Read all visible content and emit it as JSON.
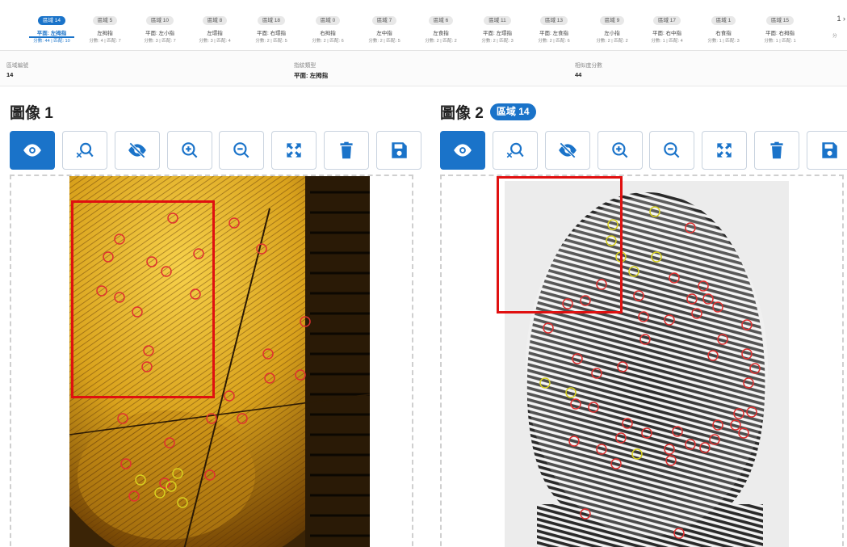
{
  "tabs": [
    {
      "area": "區域 14",
      "type": "平面: 左拇指",
      "score": "分數: 44 | 匹配: 10",
      "active": true
    },
    {
      "area": "區域 5",
      "type": "左拇指",
      "score": "分數: 4 | 匹配: 7"
    },
    {
      "area": "區域 10",
      "type": "平面: 左小指",
      "score": "分數: 3 | 匹配: 7"
    },
    {
      "area": "區域 8",
      "type": "左環指",
      "score": "分數: 3 | 匹配: 4"
    },
    {
      "area": "區域 18",
      "type": "平面: 右環指",
      "score": "分數: 2 | 匹配: 5"
    },
    {
      "area": "區域 0",
      "type": "右拇指",
      "score": "分數: 2 | 匹配: 6"
    },
    {
      "area": "區域 7",
      "type": "左中指",
      "score": "分數: 2 | 匹配: 5"
    },
    {
      "area": "區域 6",
      "type": "左食指",
      "score": "分數: 2 | 匹配: 2"
    },
    {
      "area": "區域 11",
      "type": "平面: 左環指",
      "score": "分數: 2 | 匹配: 3"
    },
    {
      "area": "區域 13",
      "type": "平面: 左食指",
      "score": "分數: 2 | 匹配: 6"
    },
    {
      "area": "區域 9",
      "type": "左小指",
      "score": "分數: 2 | 匹配: 2"
    },
    {
      "area": "區域 17",
      "type": "平面: 右中指",
      "score": "分數: 1 | 匹配: 4"
    },
    {
      "area": "區域 1",
      "type": "右食指",
      "score": "分數: 1 | 匹配: 3"
    },
    {
      "area": "區域 15",
      "type": "平面: 右拇指",
      "score": "分數: 1 | 匹配: 1"
    }
  ],
  "tab_scroll": "1 ›",
  "tab_partial": "分",
  "info": {
    "area_label": "區域編號",
    "area_value": "14",
    "type_label": "指紋類型",
    "type_value": "平面: 左拇指",
    "score_label": "相似度分數",
    "score_value": "44"
  },
  "panel1": {
    "title": "圖像 1"
  },
  "panel2": {
    "title": "圖像 2",
    "badge": "區域 14"
  },
  "toolbar_icons": [
    "eye-icon",
    "search-clear-icon",
    "eye-off-icon",
    "zoom-in-icon",
    "zoom-out-icon",
    "fit-screen-icon",
    "trash-icon",
    "save-icon"
  ],
  "colors": {
    "accent": "#1a73c9",
    "selection": "#e01010",
    "minutia_red": "#e03030",
    "minutia_yellow": "#d8d020"
  }
}
